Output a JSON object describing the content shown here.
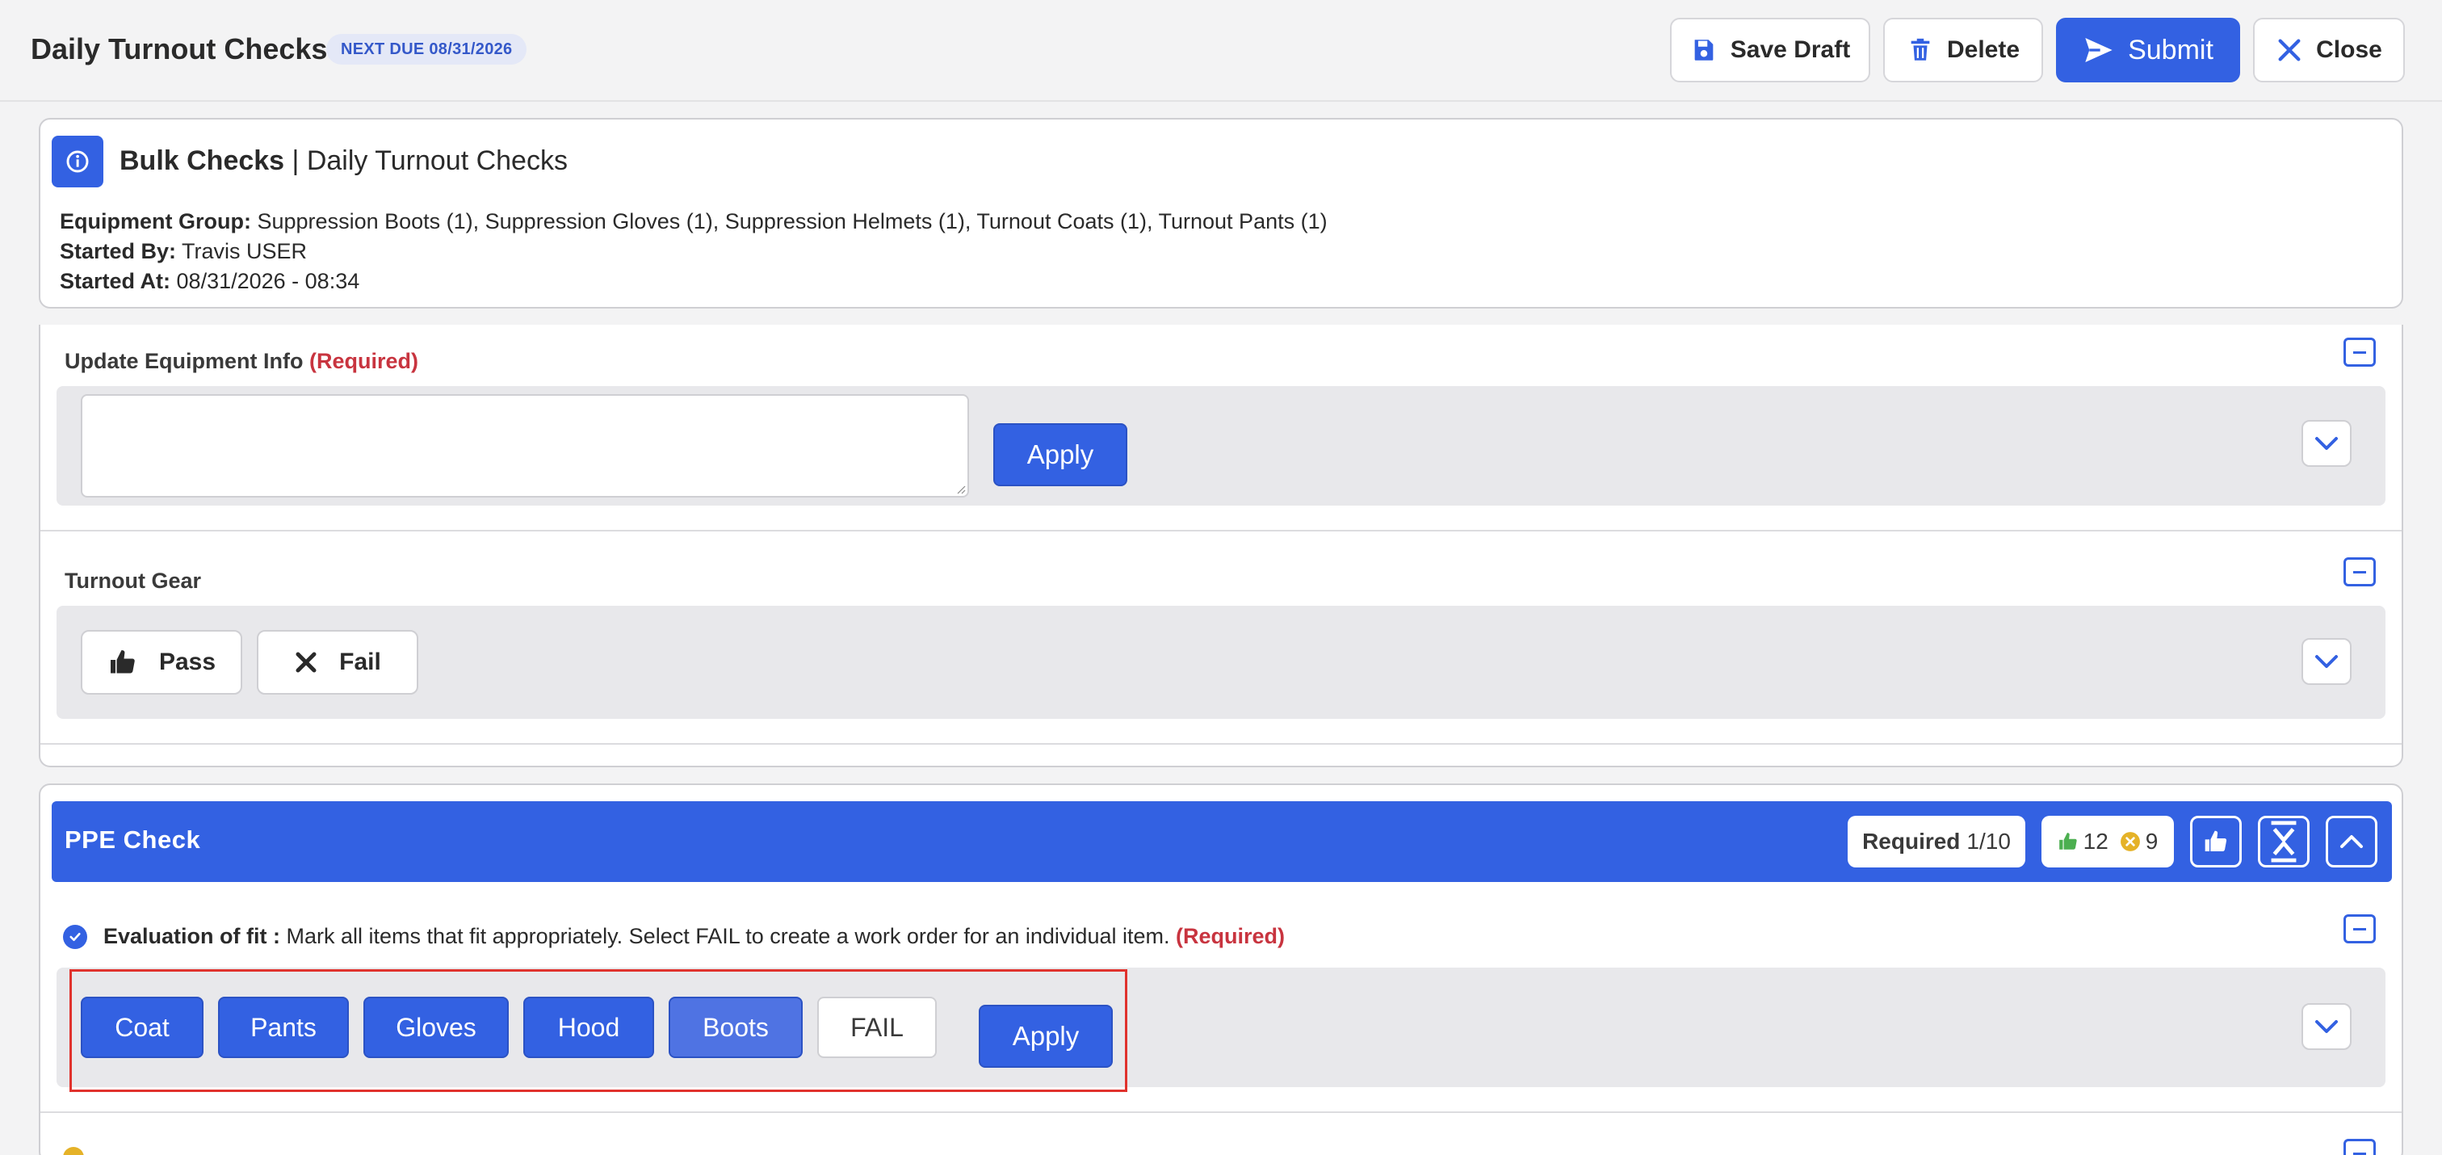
{
  "header": {
    "title": "Daily Turnout Checks",
    "due_badge": "NEXT DUE 08/31/2026",
    "save_draft": "Save Draft",
    "delete": "Delete",
    "submit": "Submit",
    "close": "Close"
  },
  "info": {
    "title_bold": "Bulk Checks",
    "title_rest": "| Daily Turnout Checks",
    "equipment_group_label": "Equipment Group:",
    "equipment_group_value": "Suppression Boots (1), Suppression Gloves (1), Suppression Helmets (1), Turnout Coats (1), Turnout Pants (1)",
    "started_by_label": "Started By:",
    "started_by_value": "Travis USER",
    "started_at_label": "Started At:",
    "started_at_value": "08/31/2026 - 08:34"
  },
  "update_info": {
    "label": "Update Equipment Info",
    "required": "(Required)",
    "textarea_value": "",
    "apply": "Apply"
  },
  "turnout_gear": {
    "label": "Turnout Gear",
    "pass": "Pass",
    "fail": "Fail"
  },
  "ppe": {
    "title": "PPE Check",
    "required_label": "Required",
    "required_count": "1/10",
    "pass_count": "12",
    "fail_count": "9",
    "eval_label": "Evaluation of fit :",
    "eval_text": "Mark all items that fit appropriately. Select FAIL to create a work order for an individual item.",
    "eval_required": "(Required)",
    "items": [
      "Coat",
      "Pants",
      "Gloves",
      "Hood",
      "Boots",
      "FAIL"
    ],
    "apply": "Apply"
  },
  "colors": {
    "accent": "#3361e2",
    "required": "#c8343f",
    "highlight": "#e0322d",
    "pass_green": "#4caf50",
    "fail_amber": "#e5b228"
  }
}
